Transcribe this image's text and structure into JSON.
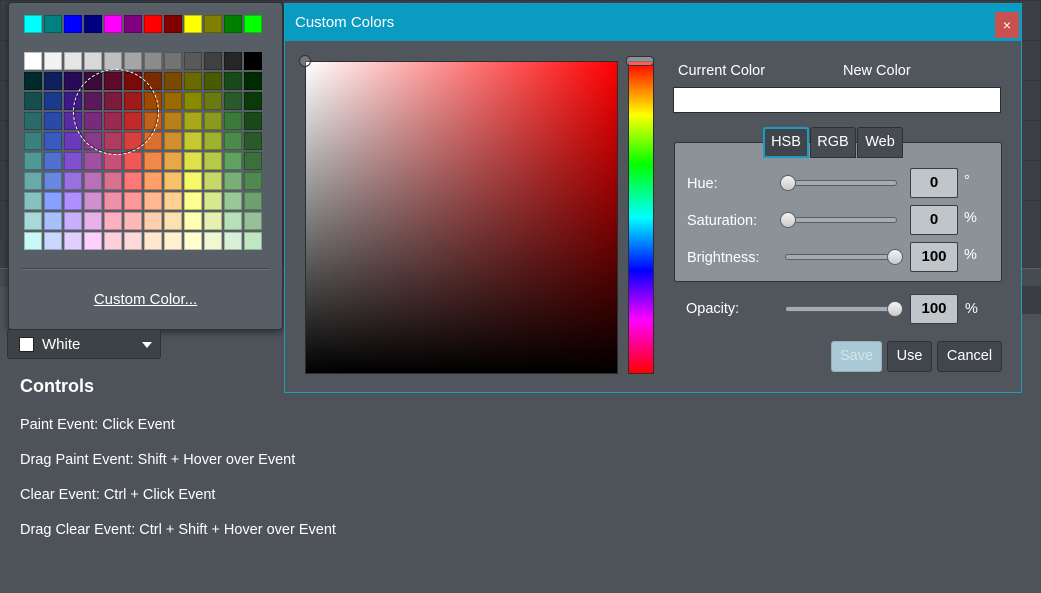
{
  "palette": {
    "top_row": [
      "#00ffff",
      "#008080",
      "#0000ff",
      "#000080",
      "#ff00ff",
      "#800080",
      "#ff0000",
      "#800000",
      "#ffff00",
      "#808000",
      "#008000",
      "#00ff00"
    ],
    "grid": [
      [
        "#ffffff",
        "#f2f2f2",
        "#e6e6e6",
        "#d9d9d9",
        "#bfbfbf",
        "#a6a6a6",
        "#8c8c8c",
        "#737373",
        "#595959",
        "#404040",
        "#262626",
        "#000000"
      ],
      [
        "#002a2a",
        "#0e1f5c",
        "#2a0a57",
        "#3a0a3a",
        "#5c0a2a",
        "#7a0a0a",
        "#7a2a00",
        "#7a4a00",
        "#6a6a00",
        "#4a5a00",
        "#1a4a1a",
        "#002a00"
      ],
      [
        "#134f4f",
        "#1a3a8a",
        "#3d1a85",
        "#5a1a5a",
        "#7a1a3d",
        "#a01a1a",
        "#a04a00",
        "#9a6a00",
        "#8a8a00",
        "#6a7a10",
        "#2a5a2a",
        "#0a3a0a"
      ],
      [
        "#2a6a6a",
        "#2a4aa8",
        "#5a2aa0",
        "#7a2a7a",
        "#9a2a50",
        "#c02a2a",
        "#c0601a",
        "#b8801a",
        "#a8a81a",
        "#8a9a20",
        "#3a7a3a",
        "#1a4a1a"
      ],
      [
        "#3a8080",
        "#3a5ac0",
        "#6a3ab8",
        "#8a3a8a",
        "#b03a60",
        "#d84040",
        "#d87030",
        "#d09030",
        "#c8c830",
        "#a0b030",
        "#4a8a4a",
        "#2a5a2a"
      ],
      [
        "#509898",
        "#5070d0",
        "#8050d0",
        "#a050a0",
        "#c85078",
        "#f05858",
        "#f08848",
        "#e8a848",
        "#e0e048",
        "#b8c848",
        "#60a060",
        "#3a703a"
      ],
      [
        "#68aaaa",
        "#6888e0",
        "#9870e0",
        "#b870b8",
        "#d87090",
        "#ff7878",
        "#ffa068",
        "#f8c068",
        "#f8f868",
        "#c8d868",
        "#78b078",
        "#508850"
      ],
      [
        "#88c0c0",
        "#88a0ff",
        "#b090ff",
        "#d090d0",
        "#f090a8",
        "#ff9898",
        "#ffb890",
        "#ffd090",
        "#ffff90",
        "#d8e890",
        "#98c898",
        "#70a070"
      ],
      [
        "#a8d8d8",
        "#a8c0ff",
        "#c8b0ff",
        "#e8b0e8",
        "#ffb0c0",
        "#ffb8b8",
        "#ffd0b0",
        "#ffe0b0",
        "#ffffb0",
        "#e8f0b0",
        "#b8e0b8",
        "#98c098"
      ],
      [
        "#c8f8f8",
        "#c8d8ff",
        "#e0d0ff",
        "#ffd0ff",
        "#ffd0dc",
        "#ffd8d8",
        "#ffe8d0",
        "#fff0d0",
        "#ffffd0",
        "#f0f8d0",
        "#d8f0d8",
        "#c0e8c0"
      ]
    ],
    "custom_link": "Custom Color..."
  },
  "combo": {
    "value": "White"
  },
  "controls": {
    "title": "Controls",
    "lines": [
      "Paint Event: Click Event",
      "Drag Paint Event: Shift + Hover over Event",
      "Clear Event: Ctrl + Click Event",
      "Drag Clear Event: Ctrl + Shift + Hover over Event"
    ]
  },
  "dialog": {
    "title": "Custom Colors",
    "close": "×",
    "current_color_label": "Current Color",
    "new_color_label": "New Color",
    "tabs": [
      "HSB",
      "RGB",
      "Web"
    ],
    "active_tab": "HSB",
    "hue_label": "Hue:",
    "hue_value": "0",
    "hue_unit": "°",
    "saturation_label": "Saturation:",
    "saturation_value": "0",
    "saturation_unit": "%",
    "brightness_label": "Brightness:",
    "brightness_value": "100",
    "brightness_unit": "%",
    "opacity_label": "Opacity:",
    "opacity_value": "100",
    "opacity_unit": "%",
    "save": "Save",
    "use": "Use",
    "cancel": "Cancel",
    "accent": "#0a9bc2"
  }
}
